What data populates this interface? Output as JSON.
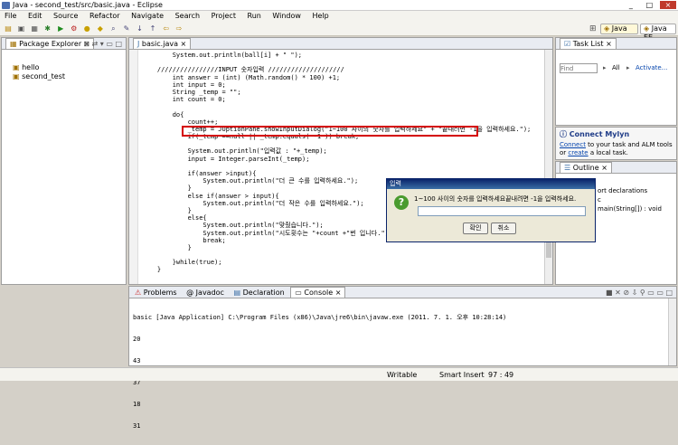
{
  "window": {
    "title": "Java - second_test/src/basic.java - Eclipse",
    "controls": [
      "_",
      "□",
      "×"
    ]
  },
  "menu": [
    "File",
    "Edit",
    "Source",
    "Refactor",
    "Navigate",
    "Search",
    "Project",
    "Run",
    "Window",
    "Help"
  ],
  "perspectives": {
    "java": "Java",
    "javaee": "Java EE"
  },
  "package_explorer": {
    "title": "Package Explorer",
    "close": "×",
    "projects": [
      {
        "name": "hello"
      },
      {
        "name": "second_test"
      }
    ]
  },
  "editor": {
    "tab": "basic.java",
    "close": "×",
    "lines": [
      "        System.out.println(ball[i] + \" \");",
      "",
      "    ////////////////INPUT 숫자입력 ////////////////////",
      "        int answer = (int) (Math.random() * 100) +1;",
      "        int input = 0;",
      "        String _temp = \"\";",
      "        int count = 0;",
      "",
      "        do{",
      "            count++;",
      "            _temp = JOptionPane.showInputDialog(\"1~100 사이의 숫자를 입력하세요\" + \"끝내려면 -1을 입력하세요.\");",
      "            if(_temp ==null || _temp.equals( -1 )) break;",
      "",
      "            System.out.println(\"입력값 : \"+_temp);",
      "            input = Integer.parseInt(_temp);",
      "",
      "            if(answer >input){",
      "                System.out.println(\"더 큰 수를 입력하세요.\");",
      "            }",
      "            else if(answer > input){",
      "                System.out.println(\"더 작은 수를 입력하세요.\");",
      "            }",
      "            else{",
      "                System.out.println(\"맞췄습니다.\");",
      "                System.out.println(\"시도횟수는 \"+count +\"번 입니다.\");",
      "                break;",
      "            }",
      "",
      "        }while(true);",
      "    }"
    ]
  },
  "tasklist": {
    "title": "Task List",
    "close": "×",
    "find_placeholder": "Find",
    "all_label": "All",
    "activate_label": "Activate..."
  },
  "mylyn": {
    "title": "Connect Mylyn",
    "connect_link": "Connect",
    "text1": " to your task and ALM tools",
    "or_text": "or ",
    "create_link": "create",
    "text2": " a local task."
  },
  "outline": {
    "title": "Outline",
    "close": "×",
    "items": [
      "ort declarations",
      "c",
      "main(String[]) : void"
    ]
  },
  "bottom": {
    "tabs": [
      "Problems",
      "@ Javadoc",
      "Declaration",
      "Console"
    ],
    "close": "×",
    "console_header": "basic [Java Application] C:\\Program Files (x86)\\Java\\jre6\\bin\\javaw.exe (2011. 7. 1. 오후 10:28:14)",
    "output": [
      "20",
      "43",
      "37",
      "18",
      "31"
    ]
  },
  "dialog": {
    "title": "입력",
    "message": "1~100 사이의 숫자를 입력하세요끝내려면 -1을 입력하세요.",
    "input_value": "",
    "ok": "확인",
    "cancel": "취소",
    "question_glyph": "?"
  },
  "status": {
    "writable": "Writable",
    "insert": "Smart Insert",
    "pos": "97 : 49"
  },
  "colors": {
    "highlight_box": "#d40000",
    "accent": "#0a246a"
  }
}
